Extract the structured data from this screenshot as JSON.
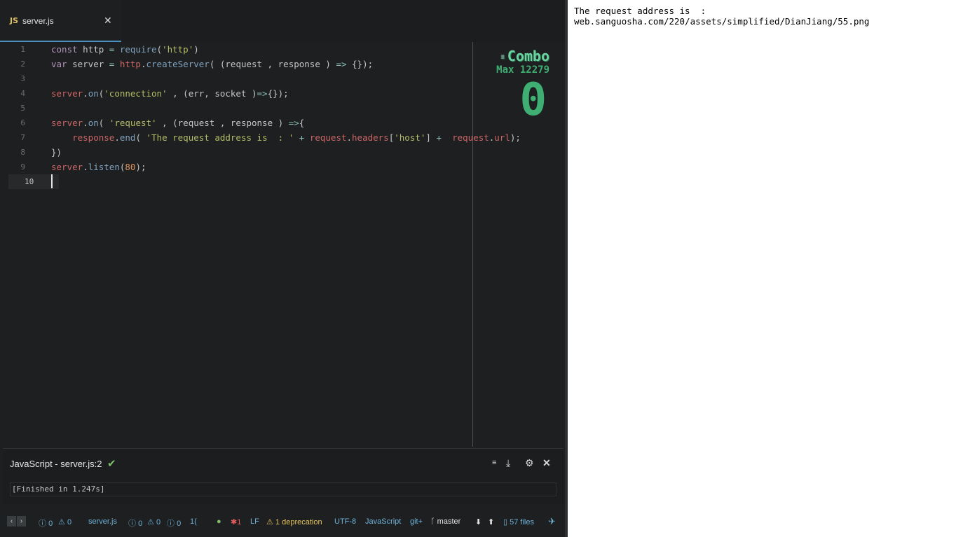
{
  "editor": {
    "tab": {
      "icon": "JS",
      "title": "server.js",
      "close": "✕"
    },
    "lines": [
      {
        "n": "1",
        "tokens": [
          [
            "kw",
            "const"
          ],
          [
            "pl",
            " http "
          ],
          [
            "op",
            "="
          ],
          [
            "pl",
            " "
          ],
          [
            "fn",
            "require"
          ],
          [
            "pl",
            "("
          ],
          [
            "str",
            "'http'"
          ],
          [
            "pl",
            ")"
          ]
        ]
      },
      {
        "n": "2",
        "tokens": [
          [
            "kw",
            "var"
          ],
          [
            "pl",
            " server "
          ],
          [
            "op",
            "="
          ],
          [
            "pl",
            " "
          ],
          [
            "var",
            "http"
          ],
          [
            "pl",
            "."
          ],
          [
            "fn",
            "createServer"
          ],
          [
            "pl",
            "( (request , response ) "
          ],
          [
            "op",
            "=>"
          ],
          [
            "pl",
            " {});"
          ]
        ]
      },
      {
        "n": "3",
        "tokens": []
      },
      {
        "n": "4",
        "tokens": [
          [
            "var",
            "server"
          ],
          [
            "pl",
            "."
          ],
          [
            "fn",
            "on"
          ],
          [
            "pl",
            "("
          ],
          [
            "str",
            "'connection'"
          ],
          [
            "pl",
            " , (err, socket )"
          ],
          [
            "op",
            "=>"
          ],
          [
            "pl",
            "{});"
          ]
        ]
      },
      {
        "n": "5",
        "tokens": []
      },
      {
        "n": "6",
        "tokens": [
          [
            "var",
            "server"
          ],
          [
            "pl",
            "."
          ],
          [
            "fn",
            "on"
          ],
          [
            "pl",
            "( "
          ],
          [
            "str",
            "'request'"
          ],
          [
            "pl",
            " , (request , response ) "
          ],
          [
            "op",
            "=>"
          ],
          [
            "pl",
            "{"
          ]
        ]
      },
      {
        "n": "7",
        "tokens": [
          [
            "pl",
            "    "
          ],
          [
            "var",
            "response"
          ],
          [
            "pl",
            "."
          ],
          [
            "fn",
            "end"
          ],
          [
            "pl",
            "( "
          ],
          [
            "str",
            "'The request address is  : '"
          ],
          [
            "pl",
            " "
          ],
          [
            "op",
            "+"
          ],
          [
            "pl",
            " "
          ],
          [
            "var",
            "request"
          ],
          [
            "pl",
            "."
          ],
          [
            "var",
            "headers"
          ],
          [
            "pl",
            "["
          ],
          [
            "str",
            "'host'"
          ],
          [
            "pl",
            "] "
          ],
          [
            "op",
            "+"
          ],
          [
            "pl",
            "  "
          ],
          [
            "var",
            "request"
          ],
          [
            "pl",
            "."
          ],
          [
            "var",
            "url"
          ],
          [
            "pl",
            ");"
          ]
        ]
      },
      {
        "n": "8",
        "tokens": [
          [
            "pl",
            "})"
          ]
        ]
      },
      {
        "n": "9",
        "tokens": [
          [
            "var",
            "server"
          ],
          [
            "pl",
            "."
          ],
          [
            "fn",
            "listen"
          ],
          [
            "pl",
            "("
          ],
          [
            "num",
            "80"
          ],
          [
            "pl",
            ");"
          ]
        ]
      },
      {
        "n": "10",
        "tokens": []
      }
    ],
    "combo": {
      "label": "Combo",
      "max": "Max 12279",
      "count": "0"
    }
  },
  "panel": {
    "title": "JavaScript - server.js:2",
    "output": "[Finished in 1.247s]"
  },
  "status_bar": {
    "errors": "0",
    "warnings": "0",
    "file": "server.js",
    "lint_info": "0",
    "lint_warn": "0",
    "lint_hint": "0",
    "column": "1(",
    "bugs": "1",
    "line_ending": "LF",
    "deprecations": "1 deprecation",
    "encoding": "UTF-8",
    "grammar": "JavaScript",
    "git": "git+",
    "branch": "master",
    "files": "57 files"
  },
  "browser": {
    "text": "The request address is  :\nweb.sanguosha.com/220/assets/simplified/DianJiang/55.png"
  },
  "colors": {
    "editor_bg": "#1d1f21",
    "combo_green": "#3fae72",
    "accent_blue": "#6fb3d8",
    "warning_yellow": "#e4c25e",
    "error_red": "#e45c5c"
  }
}
